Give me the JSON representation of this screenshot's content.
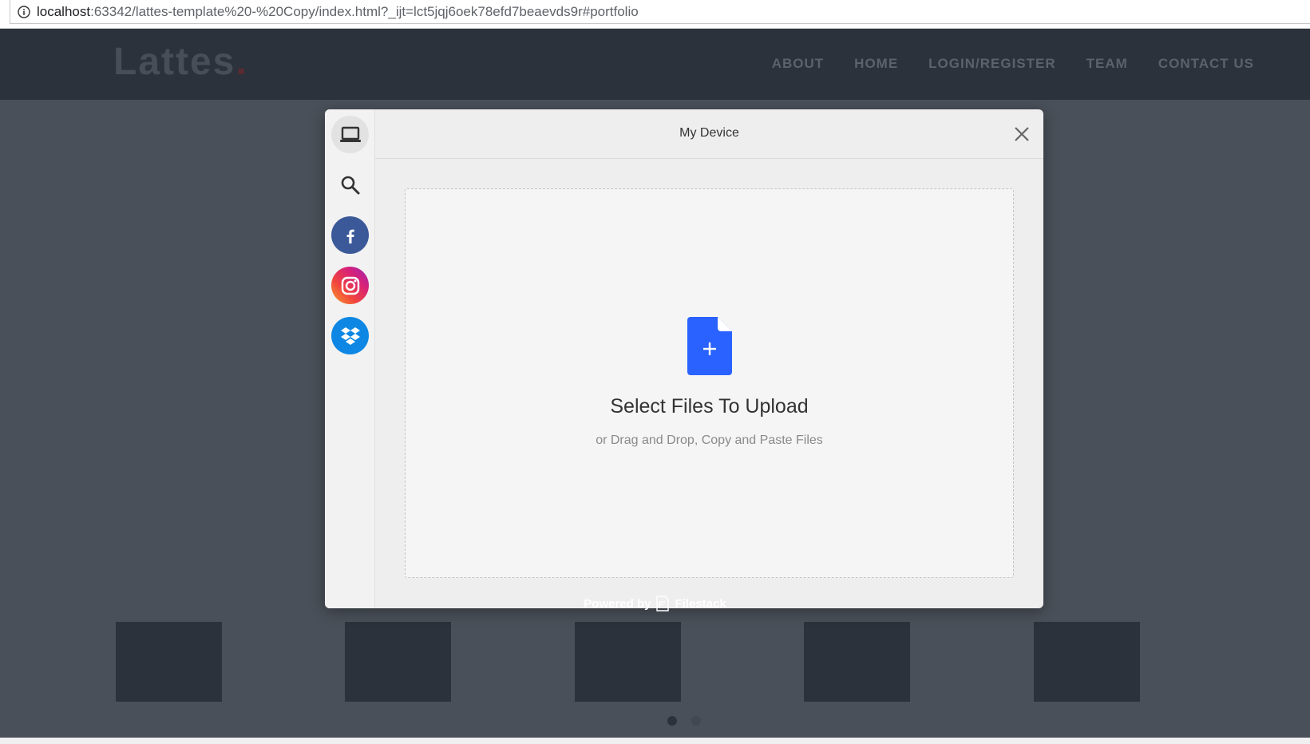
{
  "browser": {
    "url_host": "localhost",
    "url_rest": ":63342/lattes-template%20-%20Copy/index.html?_ijt=lct5jqj6oek78efd7beaevds9r#portfolio"
  },
  "site": {
    "logo_text": "Lattes",
    "logo_dot": ".",
    "nav": [
      {
        "label": "ABOUT"
      },
      {
        "label": "HOME"
      },
      {
        "label": "LOGIN/REGISTER"
      },
      {
        "label": "TEAM"
      },
      {
        "label": "CONTACT US"
      }
    ]
  },
  "picker": {
    "title": "My Device",
    "sources": [
      {
        "name": "My Device",
        "icon": "laptop-icon",
        "active": true
      },
      {
        "name": "Web Search",
        "icon": "search-icon"
      },
      {
        "name": "Facebook",
        "icon": "facebook-icon",
        "color": "#3b5998"
      },
      {
        "name": "Instagram",
        "icon": "instagram-icon"
      },
      {
        "name": "Dropbox",
        "icon": "dropbox-icon",
        "color": "#0d87e3"
      }
    ],
    "drop_title": "Select Files To Upload",
    "drop_subtitle": "or Drag and Drop, Copy and Paste Files",
    "powered_by": "Powered by",
    "brand": "Filestack",
    "accent_color": "#2962ff"
  },
  "carousel": {
    "active_dot": 0,
    "dot_count": 2
  }
}
